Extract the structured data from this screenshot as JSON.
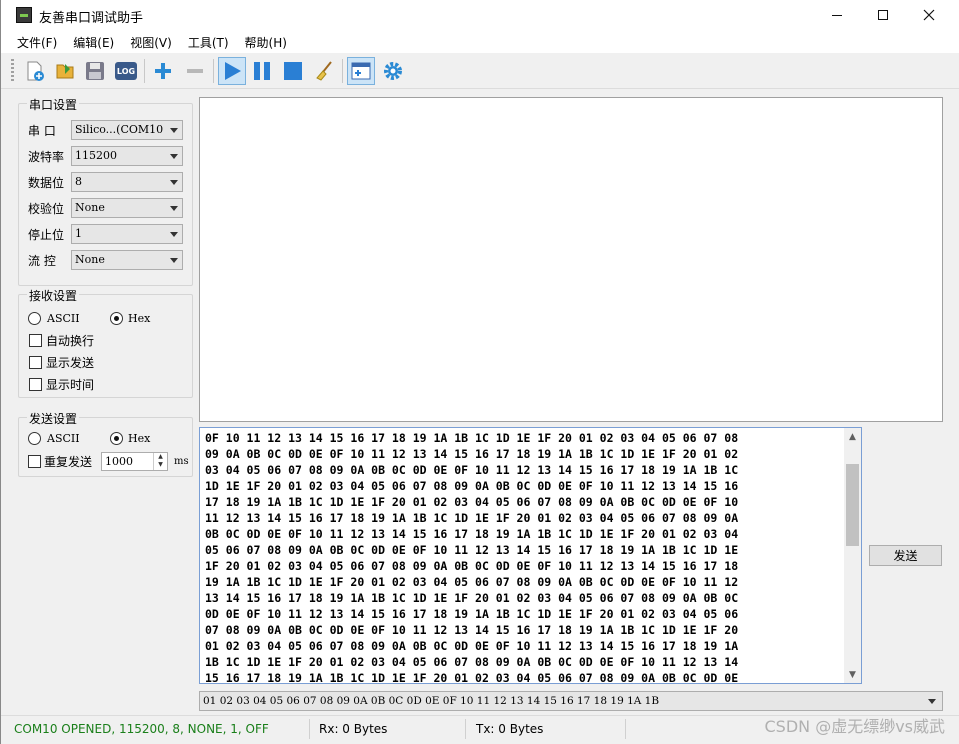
{
  "window": {
    "title": "友善串口调试助手",
    "minimize_glyph": "—",
    "maximize_glyph": "☐",
    "close_glyph": "✕"
  },
  "menu": [
    "文件(F)",
    "编辑(E)",
    "视图(V)",
    "工具(T)",
    "帮助(H)"
  ],
  "toolbar": {
    "log_label": "LOG",
    "icons": [
      "new-file-icon",
      "open-folder-icon",
      "save-icon",
      "log-icon",
      "plus-icon",
      "minus-icon",
      "play-icon",
      "pause-icon",
      "stop-icon",
      "clear-broom-icon",
      "window-add-icon",
      "settings-gear-icon"
    ]
  },
  "serial_settings": {
    "title": "串口设置",
    "port_label": "串  口",
    "port_value": "Silico...(COM10",
    "baud_label": "波特率",
    "baud_value": "115200",
    "data_bits_label": "数据位",
    "data_bits_value": "8",
    "parity_label": "校验位",
    "parity_value": "None",
    "stop_bits_label": "停止位",
    "stop_bits_value": "1",
    "flow_label": "流  控",
    "flow_value": "None"
  },
  "receive_settings": {
    "title": "接收设置",
    "ascii_label": "ASCII",
    "hex_label": "Hex",
    "selected": "Hex",
    "auto_newline": "自动换行",
    "show_send": "显示发送",
    "show_time": "显示时间"
  },
  "send_settings": {
    "title": "发送设置",
    "ascii_label": "ASCII",
    "hex_label": "Hex",
    "selected": "Hex",
    "repeat_label": "重复发送",
    "repeat_value": "1000",
    "unit": "ms"
  },
  "send_area": {
    "lines": [
      "0F 10 11 12 13 14 15 16 17 18 19 1A 1B 1C 1D 1E 1F 20 01 02 03 04 05 06 07 08",
      "09 0A 0B 0C 0D 0E 0F 10 11 12 13 14 15 16 17 18 19 1A 1B 1C 1D 1E 1F 20 01 02",
      "03 04 05 06 07 08 09 0A 0B 0C 0D 0E 0F 10 11 12 13 14 15 16 17 18 19 1A 1B 1C",
      "1D 1E 1F 20 01 02 03 04 05 06 07 08 09 0A 0B 0C 0D 0E 0F 10 11 12 13 14 15 16",
      "17 18 19 1A 1B 1C 1D 1E 1F 20 01 02 03 04 05 06 07 08 09 0A 0B 0C 0D 0E 0F 10",
      "11 12 13 14 15 16 17 18 19 1A 1B 1C 1D 1E 1F 20 01 02 03 04 05 06 07 08 09 0A",
      "0B 0C 0D 0E 0F 10 11 12 13 14 15 16 17 18 19 1A 1B 1C 1D 1E 1F 20 01 02 03 04",
      "05 06 07 08 09 0A 0B 0C 0D 0E 0F 10 11 12 13 14 15 16 17 18 19 1A 1B 1C 1D 1E",
      "1F 20 01 02 03 04 05 06 07 08 09 0A 0B 0C 0D 0E 0F 10 11 12 13 14 15 16 17 18",
      "19 1A 1B 1C 1D 1E 1F 20 01 02 03 04 05 06 07 08 09 0A 0B 0C 0D 0E 0F 10 11 12",
      "13 14 15 16 17 18 19 1A 1B 1C 1D 1E 1F 20 01 02 03 04 05 06 07 08 09 0A 0B 0C",
      "0D 0E 0F 10 11 12 13 14 15 16 17 18 19 1A 1B 1C 1D 1E 1F 20 01 02 03 04 05 06",
      "07 08 09 0A 0B 0C 0D 0E 0F 10 11 12 13 14 15 16 17 18 19 1A 1B 1C 1D 1E 1F 20",
      "01 02 03 04 05 06 07 08 09 0A 0B 0C 0D 0E 0F 10 11 12 13 14 15 16 17 18 19 1A",
      "1B 1C 1D 1E 1F 20 01 02 03 04 05 06 07 08 09 0A 0B 0C 0D 0E 0F 10 11 12 13 14",
      "15 16 17 18 19 1A 1B 1C 1D 1E 1F 20 01 02 03 04 05 06 07 08 09 0A 0B 0C 0D 0E"
    ],
    "send_button": "发送",
    "history_value": "01 02 03 04 05 06 07 08 09 0A 0B 0C 0D 0E 0F 10 11 12 13 14 15 16 17 18 19 1A 1B"
  },
  "status": {
    "connection": "COM10 OPENED, 115200, 8, NONE, 1, OFF",
    "connection_color": "#1a7f1a",
    "rx": "Rx: 0 Bytes",
    "tx": "Tx: 0 Bytes",
    "watermark": "CSDN @虚无缥缈vs威武"
  },
  "colors": {
    "accent": "#2a7fd4",
    "window_bg": "#f0f0f0"
  }
}
